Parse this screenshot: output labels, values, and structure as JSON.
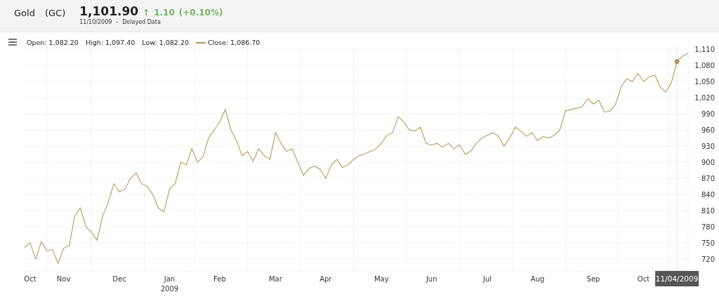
{
  "quote": {
    "name": "Gold",
    "symbol": "(GC)",
    "price": "1,101.90",
    "arrow": "↑",
    "change": "1.10",
    "change_percent": "(+0.10%)",
    "date": "11/10/2009",
    "separator": "-",
    "note": "Delayed Data"
  },
  "legend": {
    "open": "Open: 1,082.20",
    "high": "High: 1,097.40",
    "low": "Low: 1,082.20",
    "close": "Close: 1,086.70"
  },
  "chart": {
    "chart_data": {
      "type": "line",
      "grid": true,
      "ylim": [
        698,
        1110
      ],
      "yticks": [
        {
          "value": 720,
          "label": "720"
        },
        {
          "value": 750,
          "label": "750"
        },
        {
          "value": 780,
          "label": "780"
        },
        {
          "value": 810,
          "label": "810"
        },
        {
          "value": 840,
          "label": "840"
        },
        {
          "value": 870,
          "label": "870"
        },
        {
          "value": 900,
          "label": "900"
        },
        {
          "value": 930,
          "label": "930"
        },
        {
          "value": 960,
          "label": "960"
        },
        {
          "value": 990,
          "label": "990"
        },
        {
          "value": 1020,
          "label": "1,020"
        },
        {
          "value": 1050,
          "label": "1,050"
        },
        {
          "value": 1080,
          "label": "1,080"
        },
        {
          "value": 1110,
          "label": "1,110"
        }
      ],
      "categories": [
        null,
        "Oct",
        null,
        null,
        null,
        null,
        null,
        "Nov",
        null,
        null,
        null,
        null,
        null,
        null,
        null,
        null,
        null,
        "Dec",
        null,
        null,
        null,
        null,
        null,
        null,
        null,
        null,
        "Jan\n2009",
        null,
        null,
        null,
        null,
        null,
        null,
        null,
        null,
        "Feb",
        null,
        null,
        null,
        null,
        null,
        null,
        null,
        null,
        null,
        "Mar",
        null,
        null,
        null,
        null,
        null,
        null,
        null,
        null,
        "Apr",
        null,
        null,
        null,
        null,
        null,
        null,
        null,
        null,
        null,
        "May",
        null,
        null,
        null,
        null,
        null,
        null,
        null,
        null,
        "Jun",
        null,
        null,
        null,
        null,
        null,
        null,
        null,
        null,
        null,
        "Jul",
        null,
        null,
        null,
        null,
        null,
        null,
        null,
        null,
        "Aug",
        null,
        null,
        null,
        null,
        null,
        null,
        null,
        null,
        null,
        "Sep",
        null,
        null,
        null,
        null,
        null,
        null,
        null,
        null,
        "Oct",
        null,
        null,
        null,
        null,
        null,
        null,
        null,
        null
      ],
      "series": [
        {
          "color": "#b89a5c",
          "values": [
            742,
            750,
            720,
            752,
            735,
            738,
            712,
            740,
            745,
            800,
            815,
            780,
            770,
            755,
            800,
            825,
            860,
            845,
            850,
            870,
            880,
            860,
            855,
            840,
            815,
            808,
            850,
            860,
            900,
            895,
            925,
            900,
            910,
            945,
            960,
            975,
            998,
            960,
            940,
            912,
            920,
            902,
            925,
            912,
            905,
            955,
            935,
            920,
            925,
            900,
            875,
            888,
            893,
            887,
            870,
            895,
            905,
            890,
            895,
            905,
            912,
            915,
            920,
            925,
            935,
            950,
            955,
            985,
            975,
            960,
            958,
            965,
            935,
            932,
            935,
            928,
            935,
            925,
            932,
            915,
            920,
            935,
            945,
            950,
            955,
            948,
            930,
            945,
            965,
            958,
            948,
            955,
            940,
            948,
            945,
            950,
            960,
            995,
            998,
            1000,
            1003,
            1018,
            1008,
            1015,
            993,
            995,
            1008,
            1040,
            1055,
            1050,
            1065,
            1050,
            1058,
            1062,
            1040,
            1030,
            1048,
            1087,
            1097,
            1102
          ]
        }
      ],
      "annotations": [
        "11/04/2009"
      ]
    }
  }
}
